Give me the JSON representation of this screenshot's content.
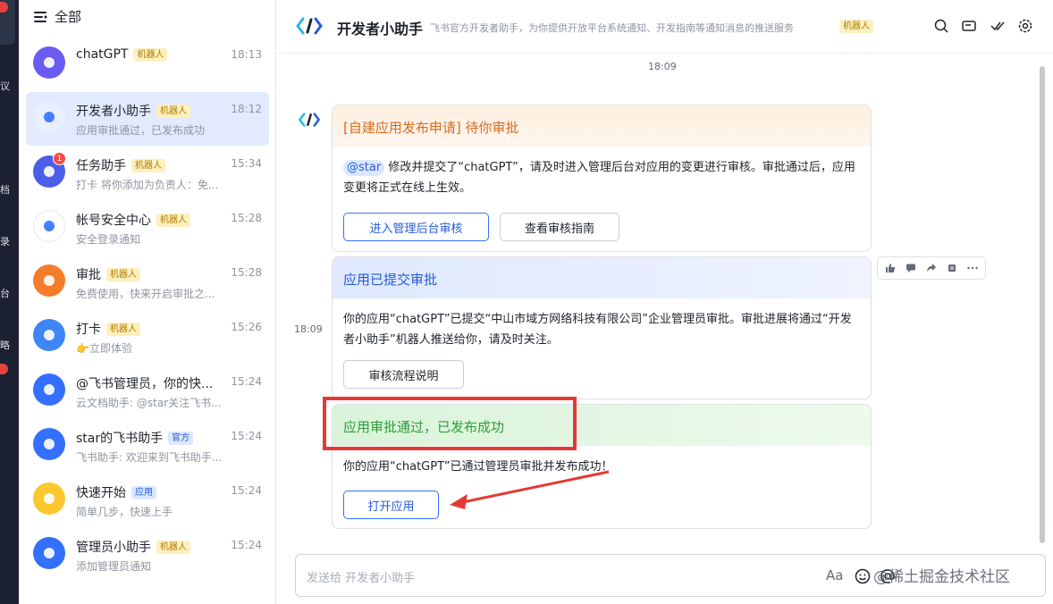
{
  "left_strip": {
    "fragments": [
      "议",
      "档",
      "录",
      "台",
      "略"
    ]
  },
  "chat_list": {
    "header": "全部",
    "items": [
      {
        "name": "chatGPT",
        "tag": "机器人",
        "time": "18:13",
        "sub": "",
        "avatar_color": "#6a5cf0"
      },
      {
        "name": "开发者小助手",
        "tag": "机器人",
        "time": "18:12",
        "sub": "应用审批通过，已发布成功",
        "avatar_color": "#e8f0ff"
      },
      {
        "name": "任务助手",
        "tag": "机器人",
        "time": "15:34",
        "sub": "打卡 将你添加为负责人：免...",
        "avatar_color": "#4b5ee8",
        "badge": "1"
      },
      {
        "name": "帐号安全中心",
        "tag": "机器人",
        "time": "15:28",
        "sub": "安全登录通知",
        "avatar_color": "#ffffff"
      },
      {
        "name": "审批",
        "tag": "机器人",
        "time": "15:28",
        "sub": "免费使用，快来开启审批之...",
        "avatar_color": "#f57c2b"
      },
      {
        "name": "打卡",
        "tag": "机器人",
        "time": "15:26",
        "sub": "👉立即体验",
        "avatar_color": "#3e86f5"
      },
      {
        "name": "@飞书管理员，你的快...",
        "tag": "",
        "time": "15:24",
        "sub": "云文档助手: @star关注飞书...",
        "avatar_color": "#3370ff"
      },
      {
        "name": "star的飞书助手",
        "tag": "官方",
        "time": "15:24",
        "sub": "飞书助手: 欢迎来到飞书助手...",
        "avatar_color": "#3370ff"
      },
      {
        "name": "快速开始",
        "tag": "应用",
        "time": "15:24",
        "sub": "简单几步，快速上手",
        "avatar_color": "#fcc82b"
      },
      {
        "name": "管理员小助手",
        "tag": "机器人",
        "time": "15:24",
        "sub": "添加管理员通知",
        "avatar_color": "#3370ff"
      }
    ]
  },
  "header": {
    "title": "开发者小助手",
    "description": "飞书官方开发者助手，为你提供开放平台系统通知、开发指南等通知消息的推送服务",
    "tag": "机器人"
  },
  "timestamp_top": "18:09",
  "timestamp_side": "18:09",
  "cards": {
    "c1": {
      "title": "[自建应用发布申请] 待你审批",
      "mention": "@star",
      "body": "修改并提交了“chatGPT”，请及时进入管理后台对应用的变更进行审核。审批通过后，应用变更将正式在线上生效。",
      "btn_primary": "进入管理后台审核",
      "btn_secondary": "查看审核指南"
    },
    "c2": {
      "title": "应用已提交审批",
      "body": "你的应用“chatGPT”已提交“中山市域方网络科技有限公司”企业管理员审批。审批进展将通过“开发者小助手”机器人推送给你，请及时关注。",
      "btn": "审核流程说明"
    },
    "c3": {
      "title": "应用审批通过，已发布成功",
      "body": "你的应用“chatGPT”已通过管理员审批并发布成功！",
      "btn": "打开应用"
    }
  },
  "composer": {
    "placeholder": "发送给 开发者小助手",
    "watermark": "@稀土掘金技术社区"
  },
  "colors": {
    "accent": "#3370ff",
    "highlight_box": "#e53935"
  }
}
